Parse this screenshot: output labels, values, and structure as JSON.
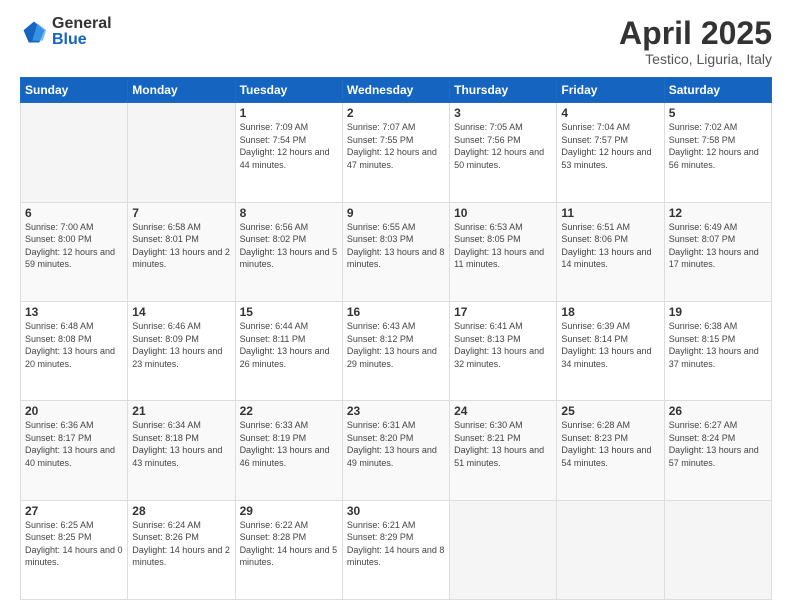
{
  "header": {
    "logo_general": "General",
    "logo_blue": "Blue",
    "month_title": "April 2025",
    "location": "Testico, Liguria, Italy"
  },
  "days_of_week": [
    "Sunday",
    "Monday",
    "Tuesday",
    "Wednesday",
    "Thursday",
    "Friday",
    "Saturday"
  ],
  "weeks": [
    [
      {
        "day": "",
        "info": ""
      },
      {
        "day": "",
        "info": ""
      },
      {
        "day": "1",
        "info": "Sunrise: 7:09 AM\nSunset: 7:54 PM\nDaylight: 12 hours and 44 minutes."
      },
      {
        "day": "2",
        "info": "Sunrise: 7:07 AM\nSunset: 7:55 PM\nDaylight: 12 hours and 47 minutes."
      },
      {
        "day": "3",
        "info": "Sunrise: 7:05 AM\nSunset: 7:56 PM\nDaylight: 12 hours and 50 minutes."
      },
      {
        "day": "4",
        "info": "Sunrise: 7:04 AM\nSunset: 7:57 PM\nDaylight: 12 hours and 53 minutes."
      },
      {
        "day": "5",
        "info": "Sunrise: 7:02 AM\nSunset: 7:58 PM\nDaylight: 12 hours and 56 minutes."
      }
    ],
    [
      {
        "day": "6",
        "info": "Sunrise: 7:00 AM\nSunset: 8:00 PM\nDaylight: 12 hours and 59 minutes."
      },
      {
        "day": "7",
        "info": "Sunrise: 6:58 AM\nSunset: 8:01 PM\nDaylight: 13 hours and 2 minutes."
      },
      {
        "day": "8",
        "info": "Sunrise: 6:56 AM\nSunset: 8:02 PM\nDaylight: 13 hours and 5 minutes."
      },
      {
        "day": "9",
        "info": "Sunrise: 6:55 AM\nSunset: 8:03 PM\nDaylight: 13 hours and 8 minutes."
      },
      {
        "day": "10",
        "info": "Sunrise: 6:53 AM\nSunset: 8:05 PM\nDaylight: 13 hours and 11 minutes."
      },
      {
        "day": "11",
        "info": "Sunrise: 6:51 AM\nSunset: 8:06 PM\nDaylight: 13 hours and 14 minutes."
      },
      {
        "day": "12",
        "info": "Sunrise: 6:49 AM\nSunset: 8:07 PM\nDaylight: 13 hours and 17 minutes."
      }
    ],
    [
      {
        "day": "13",
        "info": "Sunrise: 6:48 AM\nSunset: 8:08 PM\nDaylight: 13 hours and 20 minutes."
      },
      {
        "day": "14",
        "info": "Sunrise: 6:46 AM\nSunset: 8:09 PM\nDaylight: 13 hours and 23 minutes."
      },
      {
        "day": "15",
        "info": "Sunrise: 6:44 AM\nSunset: 8:11 PM\nDaylight: 13 hours and 26 minutes."
      },
      {
        "day": "16",
        "info": "Sunrise: 6:43 AM\nSunset: 8:12 PM\nDaylight: 13 hours and 29 minutes."
      },
      {
        "day": "17",
        "info": "Sunrise: 6:41 AM\nSunset: 8:13 PM\nDaylight: 13 hours and 32 minutes."
      },
      {
        "day": "18",
        "info": "Sunrise: 6:39 AM\nSunset: 8:14 PM\nDaylight: 13 hours and 34 minutes."
      },
      {
        "day": "19",
        "info": "Sunrise: 6:38 AM\nSunset: 8:15 PM\nDaylight: 13 hours and 37 minutes."
      }
    ],
    [
      {
        "day": "20",
        "info": "Sunrise: 6:36 AM\nSunset: 8:17 PM\nDaylight: 13 hours and 40 minutes."
      },
      {
        "day": "21",
        "info": "Sunrise: 6:34 AM\nSunset: 8:18 PM\nDaylight: 13 hours and 43 minutes."
      },
      {
        "day": "22",
        "info": "Sunrise: 6:33 AM\nSunset: 8:19 PM\nDaylight: 13 hours and 46 minutes."
      },
      {
        "day": "23",
        "info": "Sunrise: 6:31 AM\nSunset: 8:20 PM\nDaylight: 13 hours and 49 minutes."
      },
      {
        "day": "24",
        "info": "Sunrise: 6:30 AM\nSunset: 8:21 PM\nDaylight: 13 hours and 51 minutes."
      },
      {
        "day": "25",
        "info": "Sunrise: 6:28 AM\nSunset: 8:23 PM\nDaylight: 13 hours and 54 minutes."
      },
      {
        "day": "26",
        "info": "Sunrise: 6:27 AM\nSunset: 8:24 PM\nDaylight: 13 hours and 57 minutes."
      }
    ],
    [
      {
        "day": "27",
        "info": "Sunrise: 6:25 AM\nSunset: 8:25 PM\nDaylight: 14 hours and 0 minutes."
      },
      {
        "day": "28",
        "info": "Sunrise: 6:24 AM\nSunset: 8:26 PM\nDaylight: 14 hours and 2 minutes."
      },
      {
        "day": "29",
        "info": "Sunrise: 6:22 AM\nSunset: 8:28 PM\nDaylight: 14 hours and 5 minutes."
      },
      {
        "day": "30",
        "info": "Sunrise: 6:21 AM\nSunset: 8:29 PM\nDaylight: 14 hours and 8 minutes."
      },
      {
        "day": "",
        "info": ""
      },
      {
        "day": "",
        "info": ""
      },
      {
        "day": "",
        "info": ""
      }
    ]
  ]
}
